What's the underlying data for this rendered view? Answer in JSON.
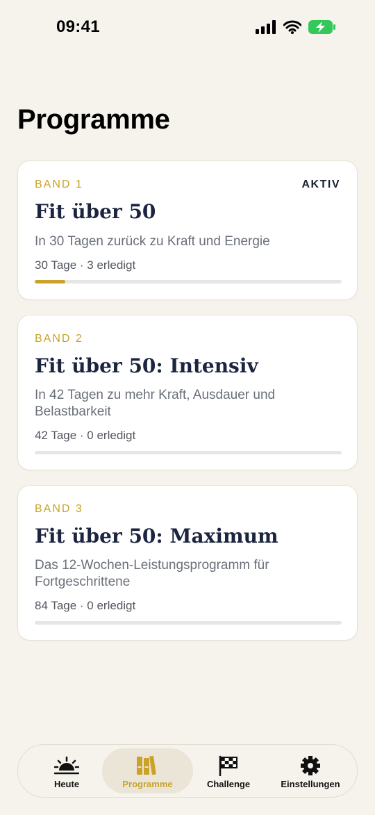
{
  "status_bar": {
    "time": "09:41"
  },
  "page": {
    "title": "Programme"
  },
  "programs": [
    {
      "band": "BAND 1",
      "active_label": "AKTIV",
      "title": "Fit über 50",
      "description": "In 30 Tagen zurück zu Kraft und Energie",
      "meta": "30 Tage · 3 erledigt",
      "progress": 0.1
    },
    {
      "band": "BAND 2",
      "title": "Fit über 50: Intensiv",
      "description": "In 42 Tagen zu mehr Kraft, Ausdauer und Belastbarkeit",
      "meta": "42 Tage · 0 erledigt",
      "progress": 0
    },
    {
      "band": "BAND 3",
      "title": "Fit über 50: Maximum",
      "description": "Das 12-Wochen-Leistungsprogramm für Fortgeschrittene",
      "meta": "84 Tage · 0 erledigt",
      "progress": 0
    }
  ],
  "tabs": [
    {
      "label": "Heute",
      "icon": "sunrise-icon"
    },
    {
      "label": "Programme",
      "icon": "books-icon",
      "active": true
    },
    {
      "label": "Challenge",
      "icon": "checkered-flag-icon"
    },
    {
      "label": "Einstellungen",
      "icon": "gear-icon"
    }
  ],
  "colors": {
    "accent": "#c9a227",
    "background": "#f6f3ec",
    "title": "#1b2540",
    "battery": "#34c759"
  }
}
